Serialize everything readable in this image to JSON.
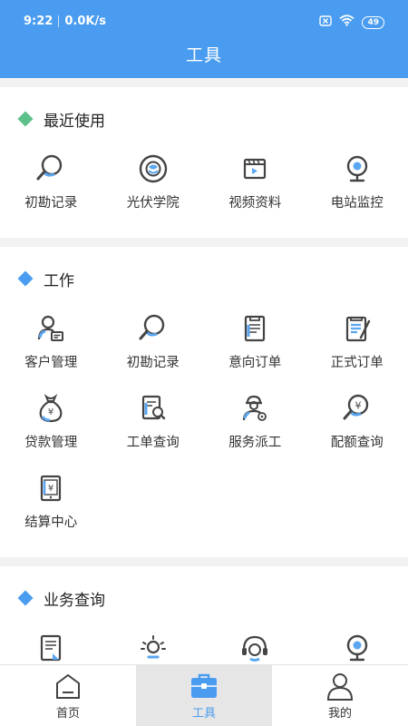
{
  "status_bar": {
    "time": "9:22",
    "speed": "0.0K/s",
    "battery": "49"
  },
  "header": {
    "title": "工具",
    "background": "#4a9cf0"
  },
  "sections": {
    "recent": {
      "title": "最近使用",
      "diamond_color": "#5cc08a",
      "items": [
        {
          "label": "初勘记录",
          "icon": "magnifier-icon"
        },
        {
          "label": "光伏学院",
          "icon": "academy-icon"
        },
        {
          "label": "视频资料",
          "icon": "video-icon"
        },
        {
          "label": "电站监控",
          "icon": "camera-icon"
        }
      ]
    },
    "work": {
      "title": "工作",
      "diamond_color": "#4a9cf0",
      "items": [
        {
          "label": "客户管理",
          "icon": "customer-icon"
        },
        {
          "label": "初勘记录",
          "icon": "magnifier-icon"
        },
        {
          "label": "意向订单",
          "icon": "intent-order-icon"
        },
        {
          "label": "正式订单",
          "icon": "formal-order-icon"
        },
        {
          "label": "贷款管理",
          "icon": "money-bag-icon"
        },
        {
          "label": "工单查询",
          "icon": "work-order-search-icon"
        },
        {
          "label": "服务派工",
          "icon": "worker-icon"
        },
        {
          "label": "配额查询",
          "icon": "quota-search-icon"
        },
        {
          "label": "结算中心",
          "icon": "settlement-icon"
        }
      ]
    },
    "business": {
      "title": "业务查询",
      "diamond_color": "#4a9cf0",
      "items": [
        {
          "label": "",
          "icon": "document-icon"
        },
        {
          "label": "",
          "icon": "sun-icon"
        },
        {
          "label": "",
          "icon": "headset-icon"
        },
        {
          "label": "",
          "icon": "camera-icon"
        }
      ]
    }
  },
  "tabbar": {
    "home": "首页",
    "tools": "工具",
    "mine": "我的"
  },
  "colors": {
    "accent": "#4a9cf0",
    "icon_dark": "#444444",
    "icon_blue": "#5aa6f0"
  }
}
